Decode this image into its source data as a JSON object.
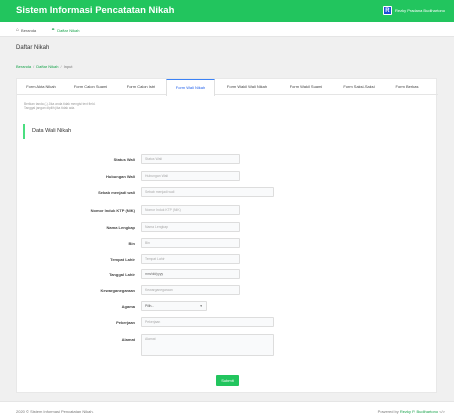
{
  "app": {
    "title": "Sistem Informasi Pencatatan Nikah",
    "user_name": "Rezky Pradana Budihartono",
    "logo_letter": "R"
  },
  "nav": {
    "home": "Beranda",
    "list": "Daftar Nikah"
  },
  "page": {
    "title": "Daftar Nikah"
  },
  "breadcrumb": {
    "home": "Beranda",
    "list": "Daftar Nikah",
    "current": "Input",
    "sep": "/"
  },
  "tabs": [
    {
      "label": "Form Akta Nikah"
    },
    {
      "label": "Form Calon Suami"
    },
    {
      "label": "Form Calon Istri"
    },
    {
      "label": "Form Wali Nikah"
    },
    {
      "label": "Form Wakil Wali Nikah"
    },
    {
      "label": "Form Wakil Suami"
    },
    {
      "label": "Form Saksi-Saksi"
    },
    {
      "label": "Form Berkas"
    }
  ],
  "notes": {
    "line1": "Berikan tanda (-) Jika anda tidak mengisi text field.",
    "line2": "Tanggal jangan dipilih jika tidak ada."
  },
  "section": {
    "title": "Data Wali Nikah"
  },
  "form": {
    "status_wali": {
      "label": "Status Wali",
      "placeholder": "Status Wali"
    },
    "hubungan_wali": {
      "label": "Hubungan Wali",
      "placeholder": "Hubungan Wali"
    },
    "sebab_wali": {
      "label": "Sebab menjadi wali",
      "placeholder": "Sebab menjadi wali"
    },
    "nik": {
      "label": "Nomor Induk KTP (NIK)",
      "placeholder": "Nomor Induk KTP (NIK)"
    },
    "nama": {
      "label": "Nama Lengkap",
      "placeholder": "Nama Lengkap"
    },
    "bin": {
      "label": "Bin",
      "placeholder": "Bin"
    },
    "tempat_lahir": {
      "label": "Tempat Lahir",
      "placeholder": "Tempat Lahir"
    },
    "tanggal_lahir": {
      "label": "Tanggal Lahir",
      "placeholder": "mm/dd/yyyy"
    },
    "kewarganegaraan": {
      "label": "Kewarganegaraan",
      "placeholder": "Kewarganegaraan"
    },
    "agama": {
      "label": "Agama",
      "selected": "Pilih..."
    },
    "pekerjaan": {
      "label": "Pekerjaan",
      "placeholder": "Pekerjaan"
    },
    "alamat": {
      "label": "Alamat",
      "placeholder": "Alamat"
    },
    "submit": "Submit"
  },
  "footer": {
    "copyright": "2020 © Sistem Informasi Pencatatan Nikah.",
    "powered": "Powered by",
    "author": "Rezky P. Budihartono",
    "code_glyph": "</>"
  },
  "colors": {
    "primary": "#22c55e",
    "active_tab": "#2563eb",
    "link": "#16a34a"
  },
  "icons": {
    "home": "home-icon",
    "list": "list-icon",
    "caret": "chevron-down-icon"
  }
}
